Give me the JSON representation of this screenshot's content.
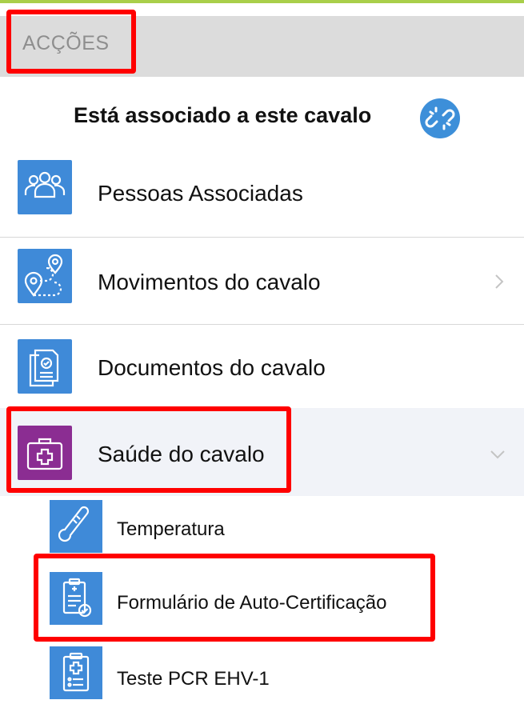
{
  "section": {
    "title": "ACÇÕES"
  },
  "association": {
    "label": "Está associado a este cavalo",
    "action_icon": "unlink-icon"
  },
  "menu": {
    "items": [
      {
        "label": "Pessoas Associadas",
        "icon": "people-icon"
      },
      {
        "label": "Movimentos do cavalo",
        "icon": "route-icon",
        "chevron": "chevron-right"
      },
      {
        "label": "Documentos do cavalo",
        "icon": "documents-icon"
      },
      {
        "label": "Saúde do cavalo",
        "icon": "medical-kit-icon",
        "chevron": "chevron-down",
        "expanded": true
      }
    ],
    "subitems": [
      {
        "label": "Temperatura",
        "icon": "thermometer-icon"
      },
      {
        "label": "Formulário de Auto-Certificação",
        "icon": "clipboard-check-icon"
      },
      {
        "label": "Teste PCR EHV-1",
        "icon": "clipboard-medical-icon"
      }
    ]
  },
  "colors": {
    "accent_line": "#a9cf4a",
    "tile_blue": "#3f8ad8",
    "tile_purple": "#8b2d92",
    "highlight": "#ff0000"
  }
}
